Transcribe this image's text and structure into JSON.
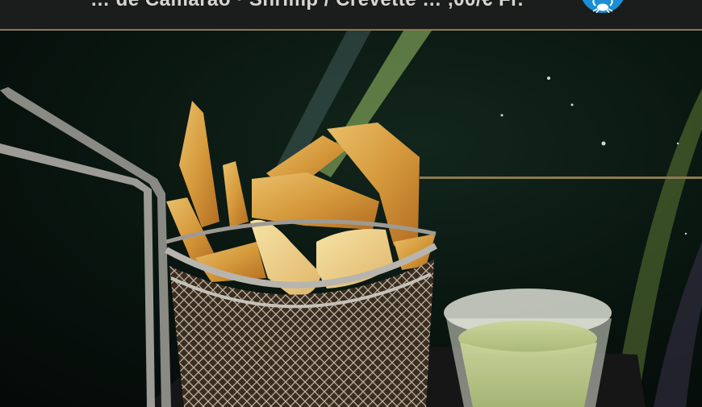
{
  "header": {
    "text": "… de Camarão · Shrimp / Crevette … ,00/€ Fr.",
    "badge_icon": "crab-icon",
    "badge_color": "#1a8fd6",
    "rule_color": "#8d7a4f"
  },
  "photo": {
    "subject_icon": "fries-basket-icon",
    "sauce_icon": "sauce-cup-icon"
  }
}
